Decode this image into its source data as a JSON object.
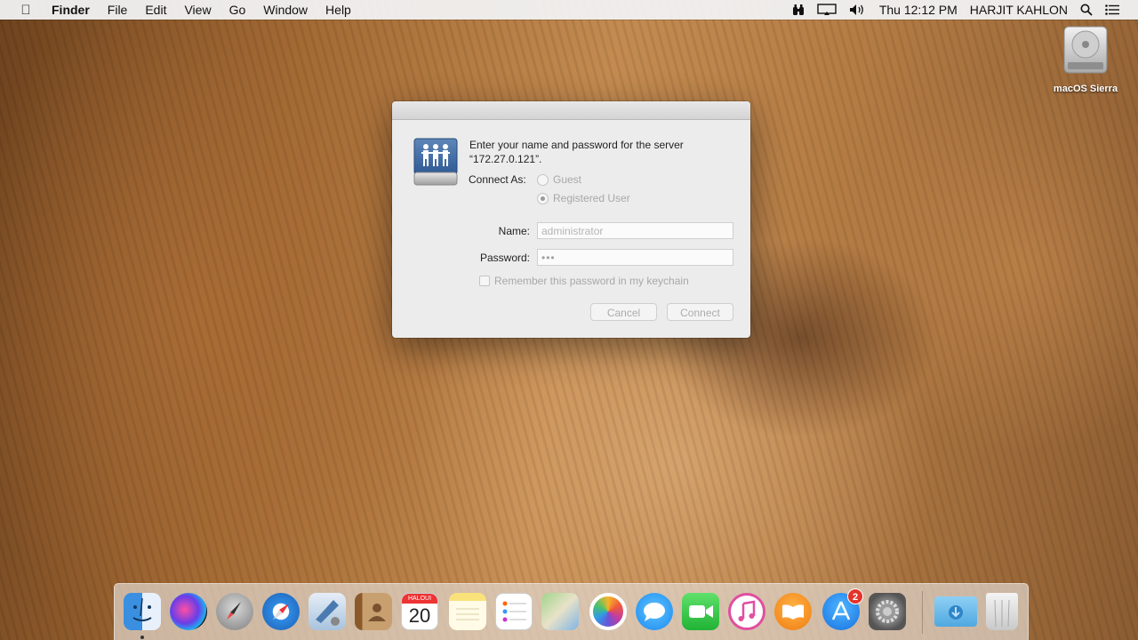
{
  "menubar": {
    "app_name": "Finder",
    "menus": [
      "File",
      "Edit",
      "View",
      "Go",
      "Window",
      "Help"
    ],
    "clock": "Thu 12:12 PM",
    "user": "HARJIT KAHLON"
  },
  "desktop": {
    "disk_label": "macOS Sierra"
  },
  "dialog": {
    "prompt_line1": "Enter your name and password for the server",
    "prompt_line2": "“172.27.0.121”.",
    "connect_as_label": "Connect As:",
    "options": [
      "Guest",
      "Registered User"
    ],
    "selected_option": "Registered User",
    "name_label": "Name:",
    "name_value": "administrator",
    "password_label": "Password:",
    "password_value": "•••",
    "remember_label": "Remember this password in my keychain",
    "remember_checked": false,
    "cancel_label": "Cancel",
    "connect_label": "Connect"
  },
  "dock": {
    "calendar_month": "HALOUI",
    "calendar_day": "20",
    "appstore_badge": "2",
    "apps": [
      "finder",
      "siri",
      "launchpad",
      "safari",
      "mail",
      "contacts",
      "calendar",
      "notes",
      "reminders",
      "maps",
      "photos",
      "messages",
      "facetime",
      "itunes",
      "ibooks",
      "app-store",
      "system-preferences",
      "downloads",
      "trash"
    ]
  }
}
